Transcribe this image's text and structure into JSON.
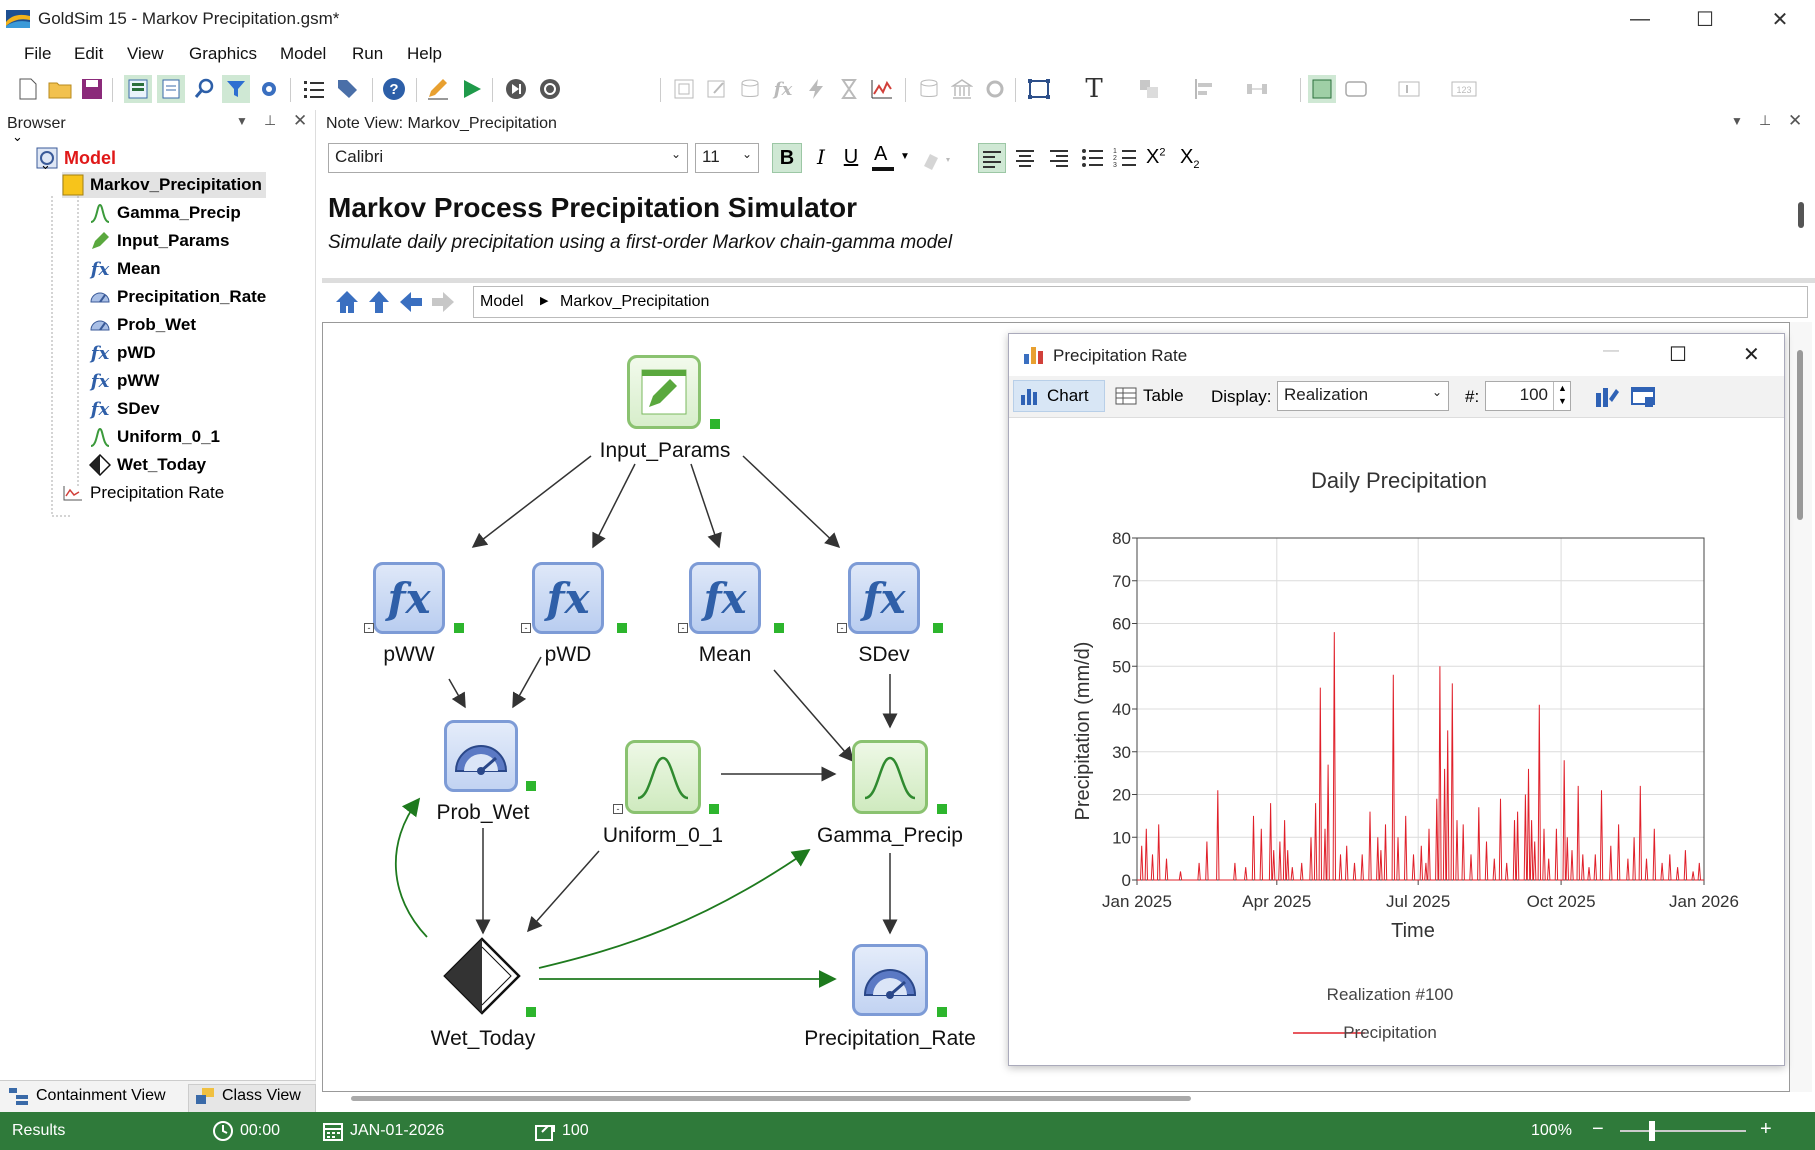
{
  "window": {
    "app": "GoldSim 15",
    "document": " - Markov Precipitation.gsm*"
  },
  "menu": [
    "File",
    "Edit",
    "View",
    "Graphics",
    "Model",
    "Run",
    "Help"
  ],
  "browser": {
    "title": "Browser",
    "root": "Model",
    "container": "Markov_Precipitation",
    "items": [
      {
        "label": "Gamma_Precip",
        "icon": "distribution-icon"
      },
      {
        "label": "Input_Params",
        "icon": "data-icon"
      },
      {
        "label": "Mean",
        "icon": "fx-icon"
      },
      {
        "label": "Precipitation_Rate",
        "icon": "gauge-icon"
      },
      {
        "label": "Prob_Wet",
        "icon": "gauge-icon"
      },
      {
        "label": "pWD",
        "icon": "fx-icon"
      },
      {
        "label": "pWW",
        "icon": "fx-icon"
      },
      {
        "label": "SDev",
        "icon": "fx-icon"
      },
      {
        "label": "Uniform_0_1",
        "icon": "distribution-icon"
      },
      {
        "label": "Wet_Today",
        "icon": "condition-icon"
      }
    ],
    "result_item": "Precipitation Rate",
    "tabs": [
      "Containment View",
      "Class View"
    ]
  },
  "note": {
    "title": "Note View: Markov_Precipitation",
    "font": "Calibri",
    "size": "11",
    "heading": "Markov Process Precipitation Simulator",
    "subheading": "Simulate daily precipitation using a first-order Markov chain-gamma model"
  },
  "nav": {
    "breadcrumb": [
      "Model",
      "Markov_Precipitation"
    ]
  },
  "nodes": {
    "input_params": "Input_Params",
    "pww": "pWW",
    "pwd": "pWD",
    "mean": "Mean",
    "sdev": "SDev",
    "prob_wet": "Prob_Wet",
    "uniform": "Uniform_0_1",
    "gamma": "Gamma_Precip",
    "wet_today": "Wet_Today",
    "precip_rate": "Precipitation_Rate"
  },
  "chartwin": {
    "title": "Precipitation Rate",
    "tab_chart": "Chart",
    "tab_table": "Table",
    "display_label": "Display:",
    "display_value": "Realization",
    "num_label": "#:",
    "num_value": "100"
  },
  "chart_data": {
    "type": "line",
    "title": "Daily Precipitation",
    "xlabel": "Time",
    "ylabel": "Precipitation (mm/d)",
    "ylim": [
      0,
      80
    ],
    "yticks": [
      "0",
      "10",
      "20",
      "30",
      "40",
      "50",
      "60",
      "70",
      "80"
    ],
    "xticks": [
      "Jan 2025",
      "Apr 2025",
      "Jul 2025",
      "Oct 2025",
      "Jan 2026"
    ],
    "legend_title": "Realization #100",
    "series": [
      {
        "name": "Precipitation",
        "color": "#e0202a",
        "points": [
          {
            "day": 3,
            "v": 8
          },
          {
            "day": 6,
            "v": 12
          },
          {
            "day": 10,
            "v": 6
          },
          {
            "day": 14,
            "v": 13
          },
          {
            "day": 19,
            "v": 5
          },
          {
            "day": 28,
            "v": 2
          },
          {
            "day": 40,
            "v": 4
          },
          {
            "day": 45,
            "v": 9
          },
          {
            "day": 52,
            "v": 21
          },
          {
            "day": 63,
            "v": 4
          },
          {
            "day": 70,
            "v": 3
          },
          {
            "day": 75,
            "v": 15
          },
          {
            "day": 80,
            "v": 12
          },
          {
            "day": 86,
            "v": 18
          },
          {
            "day": 88,
            "v": 7
          },
          {
            "day": 92,
            "v": 9
          },
          {
            "day": 95,
            "v": 14
          },
          {
            "day": 97,
            "v": 7
          },
          {
            "day": 100,
            "v": 3
          },
          {
            "day": 106,
            "v": 4
          },
          {
            "day": 112,
            "v": 10
          },
          {
            "day": 115,
            "v": 18
          },
          {
            "day": 118,
            "v": 45
          },
          {
            "day": 121,
            "v": 12
          },
          {
            "day": 123,
            "v": 27
          },
          {
            "day": 127,
            "v": 58
          },
          {
            "day": 131,
            "v": 6
          },
          {
            "day": 135,
            "v": 8
          },
          {
            "day": 140,
            "v": 4
          },
          {
            "day": 145,
            "v": 6
          },
          {
            "day": 150,
            "v": 16
          },
          {
            "day": 155,
            "v": 10
          },
          {
            "day": 157,
            "v": 7
          },
          {
            "day": 160,
            "v": 13
          },
          {
            "day": 165,
            "v": 48
          },
          {
            "day": 168,
            "v": 10
          },
          {
            "day": 173,
            "v": 15
          },
          {
            "day": 178,
            "v": 6
          },
          {
            "day": 183,
            "v": 8
          },
          {
            "day": 186,
            "v": 4
          },
          {
            "day": 188,
            "v": 12
          },
          {
            "day": 193,
            "v": 19
          },
          {
            "day": 195,
            "v": 50
          },
          {
            "day": 198,
            "v": 26
          },
          {
            "day": 200,
            "v": 35
          },
          {
            "day": 203,
            "v": 46
          },
          {
            "day": 206,
            "v": 14
          },
          {
            "day": 210,
            "v": 13
          },
          {
            "day": 215,
            "v": 6
          },
          {
            "day": 220,
            "v": 17
          },
          {
            "day": 225,
            "v": 9
          },
          {
            "day": 230,
            "v": 5
          },
          {
            "day": 234,
            "v": 19
          },
          {
            "day": 238,
            "v": 4
          },
          {
            "day": 243,
            "v": 14
          },
          {
            "day": 245,
            "v": 16
          },
          {
            "day": 250,
            "v": 20
          },
          {
            "day": 252,
            "v": 26
          },
          {
            "day": 254,
            "v": 14
          },
          {
            "day": 256,
            "v": 9
          },
          {
            "day": 259,
            "v": 41
          },
          {
            "day": 262,
            "v": 12
          },
          {
            "day": 265,
            "v": 5
          },
          {
            "day": 270,
            "v": 12
          },
          {
            "day": 275,
            "v": 28
          },
          {
            "day": 277,
            "v": 10
          },
          {
            "day": 280,
            "v": 7
          },
          {
            "day": 284,
            "v": 22
          },
          {
            "day": 287,
            "v": 6
          },
          {
            "day": 291,
            "v": 3
          },
          {
            "day": 295,
            "v": 6
          },
          {
            "day": 299,
            "v": 21
          },
          {
            "day": 305,
            "v": 8
          },
          {
            "day": 310,
            "v": 13
          },
          {
            "day": 316,
            "v": 5
          },
          {
            "day": 320,
            "v": 10
          },
          {
            "day": 324,
            "v": 22
          },
          {
            "day": 328,
            "v": 5
          },
          {
            "day": 333,
            "v": 12
          },
          {
            "day": 338,
            "v": 4
          },
          {
            "day": 343,
            "v": 6
          },
          {
            "day": 348,
            "v": 3
          },
          {
            "day": 353,
            "v": 7
          },
          {
            "day": 358,
            "v": 2
          },
          {
            "day": 362,
            "v": 4
          }
        ]
      }
    ]
  },
  "status": {
    "mode": "Results",
    "time": "00:00",
    "date": "JAN-01-2026",
    "realizations": "100",
    "zoom": "100%"
  }
}
